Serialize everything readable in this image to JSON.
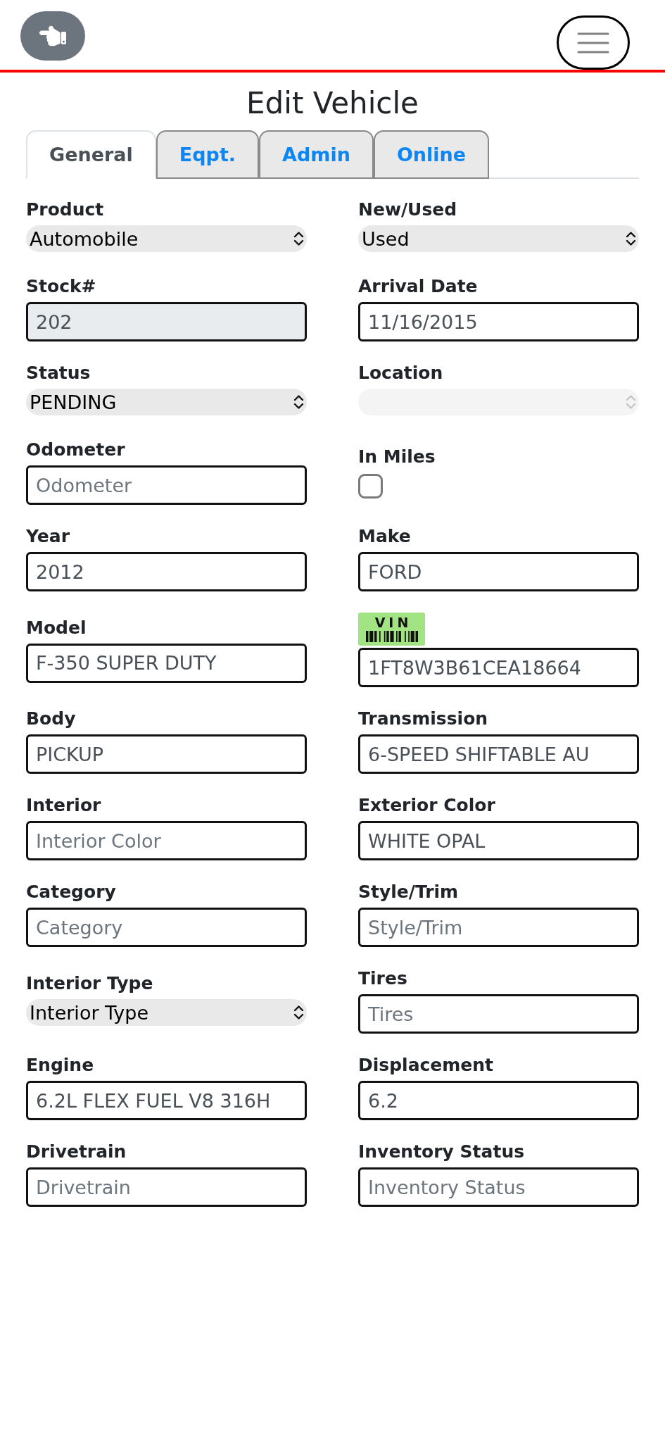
{
  "title": "Edit Vehicle",
  "tabs": [
    {
      "label": "General",
      "selected": true
    },
    {
      "label": "Eqpt.",
      "selected": false
    },
    {
      "label": "Admin",
      "selected": false
    },
    {
      "label": "Online",
      "selected": false
    }
  ],
  "fields": [
    {
      "kind": "select",
      "label": "Product",
      "value": "Automobile",
      "disabled": false
    },
    {
      "kind": "select",
      "label": "New/Used",
      "value": "Used",
      "disabled": false
    },
    {
      "kind": "input",
      "label": "Stock#",
      "value": "202",
      "disabled": true
    },
    {
      "kind": "input",
      "label": "Arrival Date",
      "value": "11/16/2015",
      "disabled": false
    },
    {
      "kind": "select",
      "label": "Status",
      "value": "PENDING",
      "disabled": false
    },
    {
      "kind": "select",
      "label": "Location",
      "disabled": true
    },
    {
      "kind": "input",
      "label": "Odometer",
      "placeholder": "Odometer",
      "disabled": false
    },
    {
      "kind": "checkbox",
      "label": "In Miles",
      "checked": false,
      "disabled": false
    },
    {
      "kind": "input",
      "label": "Year",
      "value": "2012",
      "disabled": false
    },
    {
      "kind": "input",
      "label": "Make",
      "value": "FORD",
      "disabled": false
    },
    {
      "kind": "input",
      "label": "Model",
      "value": "F-350 SUPER DUTY",
      "disabled": false
    },
    {
      "kind": "vin",
      "badge": "VIN",
      "value": "1FT8W3B61CEA18664",
      "disabled": false
    },
    {
      "kind": "input",
      "label": "Body",
      "value": "PICKUP",
      "disabled": false
    },
    {
      "kind": "input",
      "label": "Transmission",
      "value": "6-SPEED SHIFTABLE AU",
      "disabled": false
    },
    {
      "kind": "input",
      "label": "Interior",
      "placeholder": "Interior Color",
      "disabled": false
    },
    {
      "kind": "input",
      "label": "Exterior Color",
      "value": "WHITE OPAL",
      "disabled": false
    },
    {
      "kind": "input",
      "label": "Category",
      "placeholder": "Category",
      "disabled": false
    },
    {
      "kind": "input",
      "label": "Style/Trim",
      "placeholder": "Style/Trim",
      "disabled": false
    },
    {
      "kind": "select",
      "label": "Interior Type",
      "value": "Interior Type",
      "disabled": false
    },
    {
      "kind": "input",
      "label": "Tires",
      "placeholder": "Tires",
      "disabled": false
    },
    {
      "kind": "input",
      "label": "Engine",
      "value": "6.2L FLEX FUEL V8 316H",
      "disabled": false
    },
    {
      "kind": "input",
      "label": "Displacement",
      "value": "6.2",
      "disabled": false
    },
    {
      "kind": "input",
      "label": "Drivetrain",
      "placeholder": "Drivetrain",
      "disabled": false
    },
    {
      "kind": "input",
      "label": "Inventory Status",
      "placeholder": "Inventory Status",
      "disabled": false
    }
  ]
}
